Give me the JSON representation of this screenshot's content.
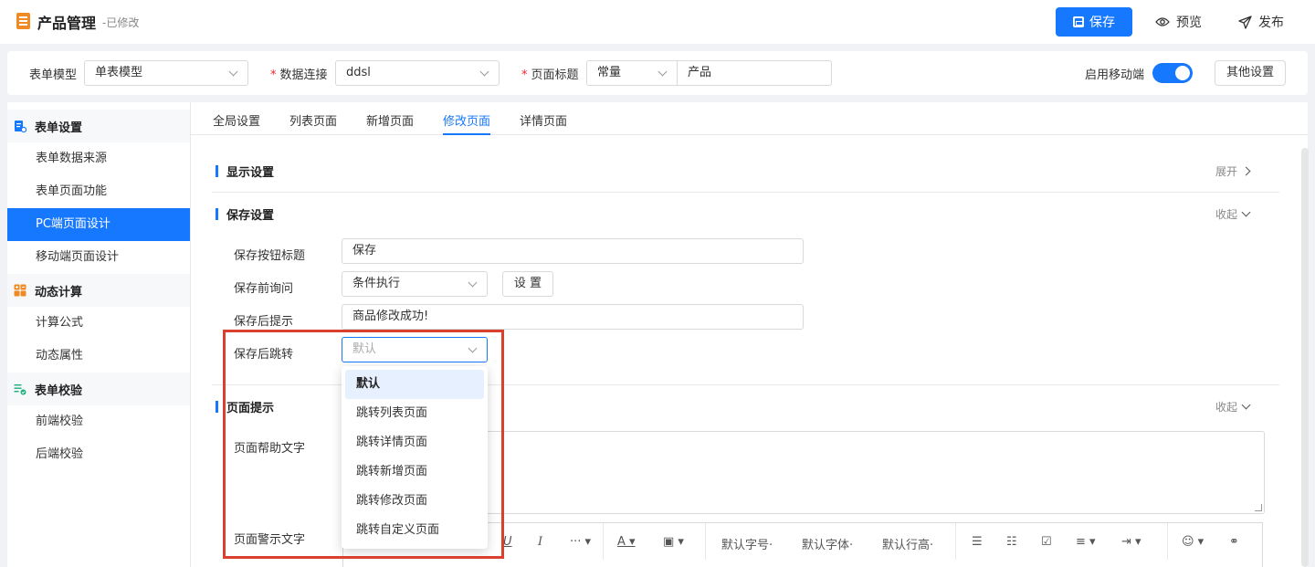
{
  "header": {
    "title": "产品管理",
    "status": "-已修改",
    "save_label": "保存",
    "preview_label": "预览",
    "publish_label": "发布"
  },
  "config": {
    "form_model_label": "表单模型",
    "form_model_value": "单表模型",
    "data_conn_label": "数据连接",
    "data_conn_value": "ddsl",
    "page_title_label": "页面标题",
    "page_title_type": "常量",
    "page_title_value": "产品",
    "mobile_label": "启用移动端",
    "mobile_enabled": true,
    "other_settings_label": "其他设置"
  },
  "sidebar": {
    "groups": [
      {
        "label": "表单设置",
        "items": [
          "表单数据来源",
          "表单页面功能",
          "PC端页面设计",
          "移动端页面设计"
        ]
      },
      {
        "label": "动态计算",
        "items": [
          "计算公式",
          "动态属性"
        ]
      },
      {
        "label": "表单校验",
        "items": [
          "前端校验",
          "后端校验"
        ]
      }
    ],
    "active_item": "PC端页面设计"
  },
  "tabs": [
    "全局设置",
    "列表页面",
    "新增页面",
    "修改页面",
    "详情页面"
  ],
  "active_tab": "修改页面",
  "sections": {
    "display": {
      "title": "显示设置",
      "toggle": "展开"
    },
    "save": {
      "title": "保存设置",
      "toggle": "收起",
      "btn_title_label": "保存按钮标题",
      "btn_title_value": "保存",
      "pre_ask_label": "保存前询问",
      "pre_ask_value": "条件执行",
      "pre_ask_button": "设 置",
      "post_tip_label": "保存后提示",
      "post_tip_value": "商品修改成功!",
      "post_jump_label": "保存后跳转",
      "post_jump_placeholder": "默认"
    },
    "tips": {
      "title": "页面提示",
      "toggle": "收起",
      "help_label": "页面帮助文字",
      "warn_label": "页面警示文字"
    }
  },
  "dropdown": {
    "options": [
      "默认",
      "跳转列表页面",
      "跳转详情页面",
      "跳转新增页面",
      "跳转修改页面",
      "跳转自定义页面"
    ],
    "selected": "默认"
  },
  "editor_toolbar": {
    "font_size": "默认字号",
    "font_family": "默认字体",
    "line_height": "默认行高"
  },
  "colors": {
    "primary": "#1677ff",
    "highlight": "#d9412e",
    "app_icon": "#f08a24"
  }
}
